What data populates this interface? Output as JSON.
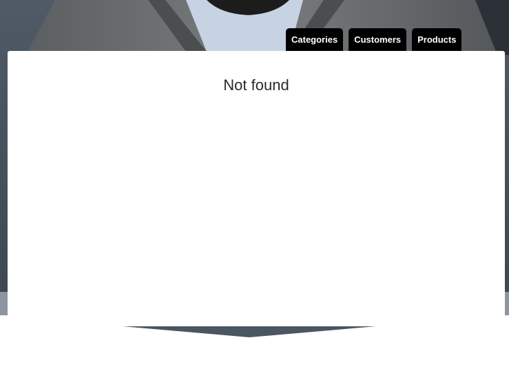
{
  "nav": {
    "items": [
      {
        "label": "Categories"
      },
      {
        "label": "Customers"
      },
      {
        "label": "Products"
      }
    ]
  },
  "content": {
    "title": "Not found"
  },
  "colors": {
    "nav_bg": "#000000",
    "nav_text": "#ffffff",
    "card_bg": "#ffffff",
    "hero_bg": "#4a5561",
    "pointer": "#4b5663"
  }
}
